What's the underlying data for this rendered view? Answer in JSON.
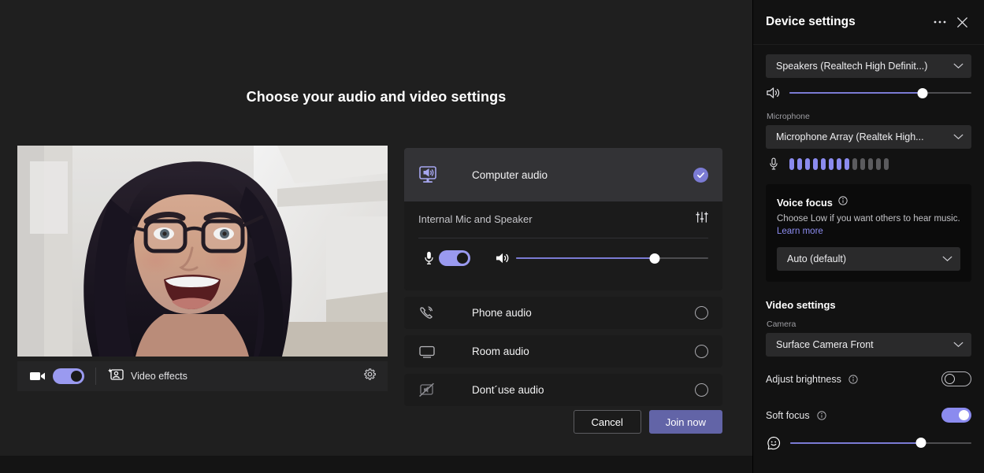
{
  "stage": {
    "title": "Choose your audio and video settings",
    "preview_bar": {
      "camera_toggle_state": "on",
      "video_effects_label": "Video effects",
      "video_effects_icon": "video-effects-icon",
      "camera_icon": "camera-icon",
      "settings_icon": "gear-icon"
    }
  },
  "audio_options": {
    "selected": "Computer audio",
    "computer_audio": {
      "label": "Computer audio",
      "icon": "computer-speaker-icon",
      "selected": true,
      "device_name": "Internal Mic and Speaker",
      "equalizer_icon": "audio-settings-icon",
      "mic_icon": "microphone-icon",
      "mic_toggle_state": "on",
      "speaker_icon": "speaker-volume-icon",
      "volume_percent": 72
    },
    "items": [
      {
        "label": "Phone audio",
        "icon": "phone-audio-icon",
        "selected": false
      },
      {
        "label": "Room audio",
        "icon": "room-display-icon",
        "selected": false
      },
      {
        "label": "Dont´use audio",
        "icon": "no-audio-icon",
        "selected": false
      }
    ]
  },
  "actions": {
    "cancel_label": "Cancel",
    "join_label": "Join now"
  },
  "panel": {
    "title": "Device settings",
    "more_icon": "more-options-icon",
    "close_icon": "close-icon",
    "speaker": {
      "value": "Speakers (Realtech High Definit...)",
      "chevron_icon": "chevron-down-icon",
      "volume_icon": "speaker-volume-icon",
      "volume_percent": 73
    },
    "microphone": {
      "label": "Microphone",
      "value": "Microphone Array (Realtek High...",
      "chevron_icon": "chevron-down-icon",
      "mic_icon": "microphone-icon",
      "meter_total": 13,
      "meter_active": 8
    },
    "voice_focus": {
      "title": "Voice focus",
      "info_icon": "info-icon",
      "description": "Choose Low if you want others to hear music.",
      "link_label": "Learn more",
      "value": "Auto (default)",
      "chevron_icon": "chevron-down-icon"
    },
    "video_settings": {
      "title": "Video settings",
      "camera_label": "Camera",
      "camera_value": "Surface Camera Front",
      "chevron_icon": "chevron-down-icon",
      "adjust_brightness": {
        "label": "Adjust brightness",
        "info_icon": "info-icon",
        "state": "off"
      },
      "soft_focus": {
        "label": "Soft focus",
        "info_icon": "info-icon",
        "state": "on",
        "icon": "soft-focus-icon",
        "level_percent": 72
      }
    }
  },
  "colors": {
    "accent": "#6264a7",
    "accent_light": "#8b8bef",
    "panel_bg": "#121212",
    "stage_bg": "#1f1f1f",
    "card_bg": "#1b1b1b"
  }
}
